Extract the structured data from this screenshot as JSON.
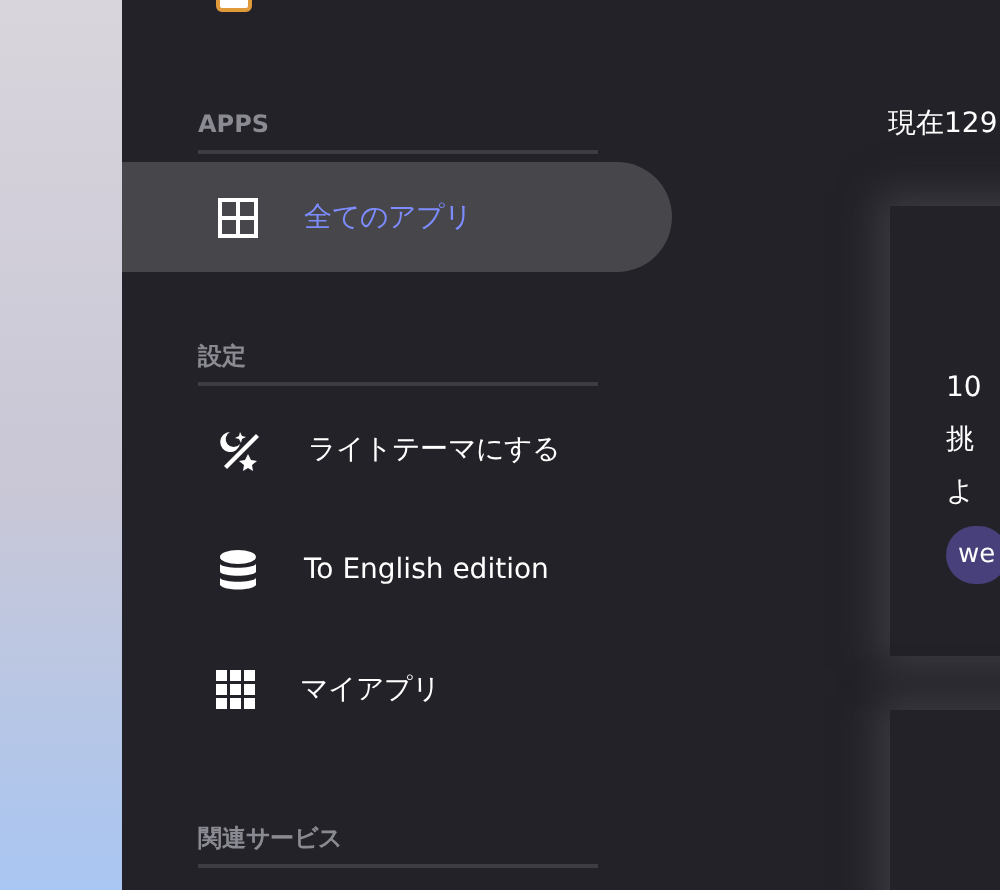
{
  "sidebar": {
    "sections": [
      {
        "title": "APPS",
        "items": [
          {
            "kind": "grid",
            "label": "全てのアプリ",
            "selected": true
          }
        ]
      },
      {
        "title": "設定",
        "items": [
          {
            "kind": "theme",
            "label": "ライトテーマにする",
            "selected": false
          },
          {
            "kind": "database",
            "label": "To English edition",
            "selected": false
          },
          {
            "kind": "apps",
            "label": "マイアプリ",
            "selected": false
          }
        ]
      },
      {
        "title": "関連サービス"
      }
    ]
  },
  "main": {
    "heading": "現在129",
    "card": {
      "lines": [
        "10",
        "挑",
        "よ"
      ],
      "tag": "we"
    }
  }
}
